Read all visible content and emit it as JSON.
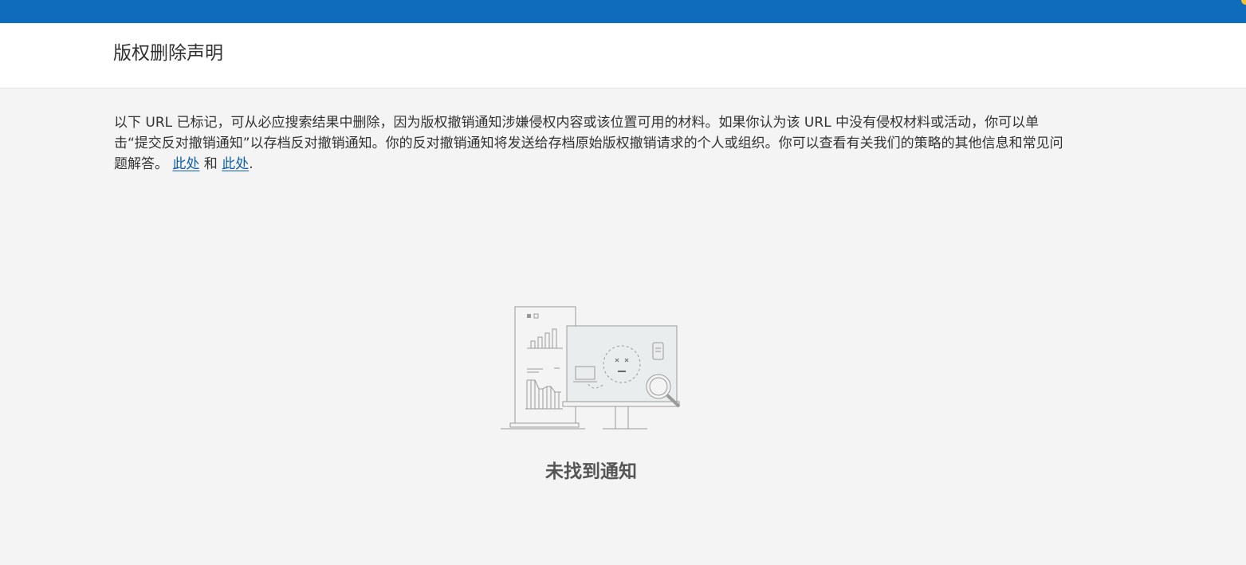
{
  "header": {
    "title": "版权删除声明"
  },
  "notice": {
    "text_before_links": "以下 URL 已标记，可从必应搜索结果中删除，因为版权撤销通知涉嫌侵权内容或该位置可用的材料。如果你认为该 URL 中没有侵权材料或活动，你可以单击“提交反对撤销通知”以存档反对撤销通知。你的反对撤销通知将发送给存档原始版权撤销请求的个人或组织。你可以查看有关我们的策略的其他信息和常见问题解答。 ",
    "link1_label": "此处",
    "connector": " 和 ",
    "link2_label": "此处",
    "trailing": "."
  },
  "empty_state": {
    "title": "未找到通知",
    "illustration_icon": "no-results-illustration"
  },
  "colors": {
    "topbar": "#0f6cbd",
    "link": "#0f5fa8",
    "background": "#f4f4f4"
  }
}
